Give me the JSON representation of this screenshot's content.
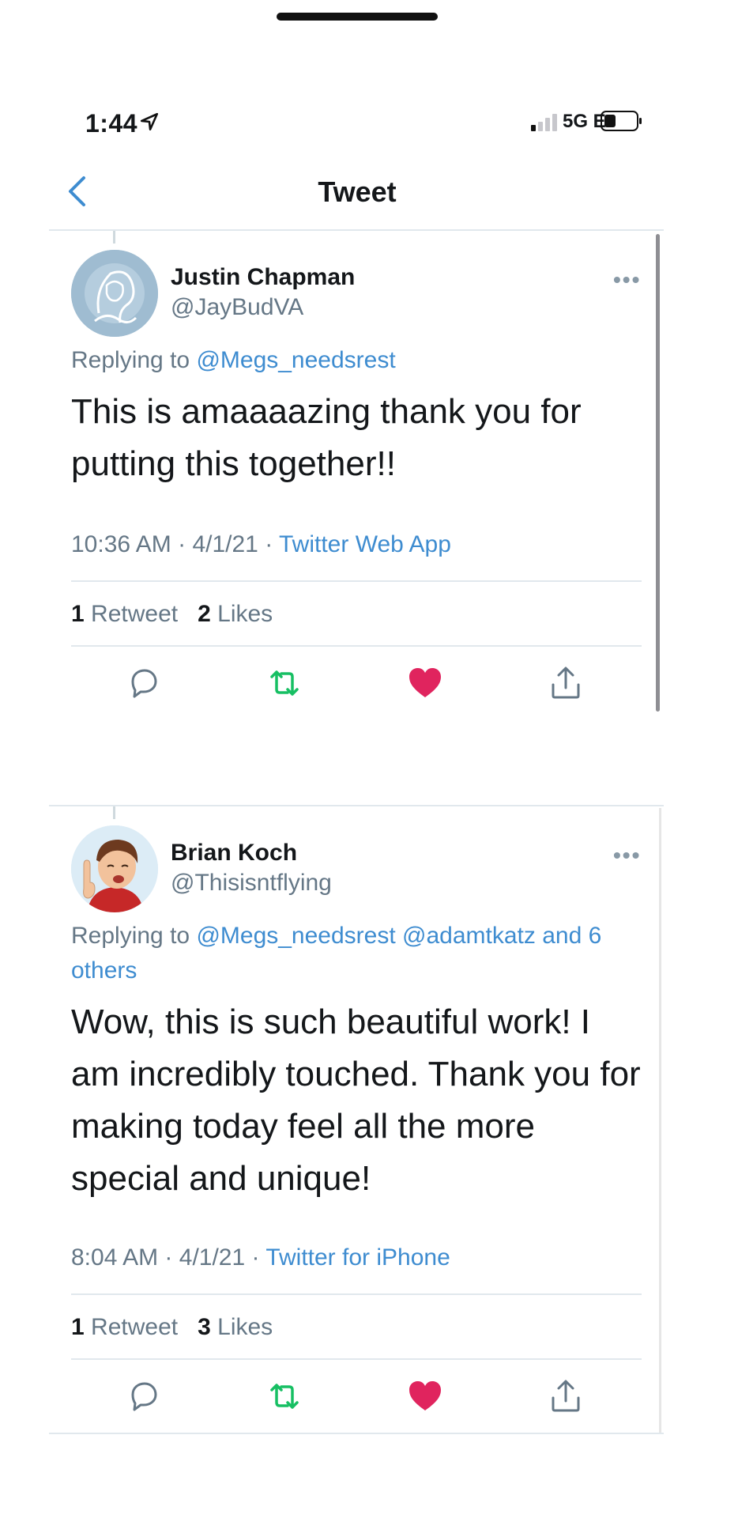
{
  "status_bar": {
    "time": "1:44",
    "network": "5G E",
    "icons": [
      "location-arrow-icon",
      "signal-icon",
      "battery-icon"
    ]
  },
  "nav": {
    "title": "Tweet",
    "back_icon": "chevron-left-icon"
  },
  "colors": {
    "accent": "#3e8cd0",
    "retweet_green": "#17bf63",
    "like_red": "#e0245e",
    "secondary_text": "#657786"
  },
  "tweets": [
    {
      "name": "Justin Chapman",
      "handle": "@JayBudVA",
      "reply_prefix": "Replying to ",
      "reply_targets": "@Megs_needsrest",
      "reply_suffix": "",
      "text_lines": [
        "This is amaaaazing thank you for",
        "putting this together!!"
      ],
      "time": "10:36 AM",
      "date": "4/1/21",
      "source": "Twitter Web App",
      "retweets_count": "1",
      "retweets_label": "Retweet",
      "likes_count": "2",
      "likes_label": "Likes",
      "liked": true,
      "retweeted": false
    },
    {
      "name": "Brian Koch",
      "handle": "@Thisisntflying",
      "reply_prefix": "Replying to ",
      "reply_targets": "@Megs_needsrest @adamtkatz and 6",
      "reply_suffix": "others",
      "text_lines": [
        "Wow, this is such beautiful work! I",
        "am incredibly touched. Thank you for",
        "making today feel all the more",
        "special and unique!"
      ],
      "time": "8:04 AM",
      "date": "4/1/21",
      "source": "Twitter for iPhone",
      "retweets_count": "1",
      "retweets_label": "Retweet",
      "likes_count": "3",
      "likes_label": "Likes",
      "liked": true,
      "retweeted": false
    }
  ],
  "separator_dot": "·",
  "more_symbol": "•••",
  "action_icons": [
    "reply-icon",
    "retweet-icon",
    "like-icon",
    "share-icon"
  ]
}
